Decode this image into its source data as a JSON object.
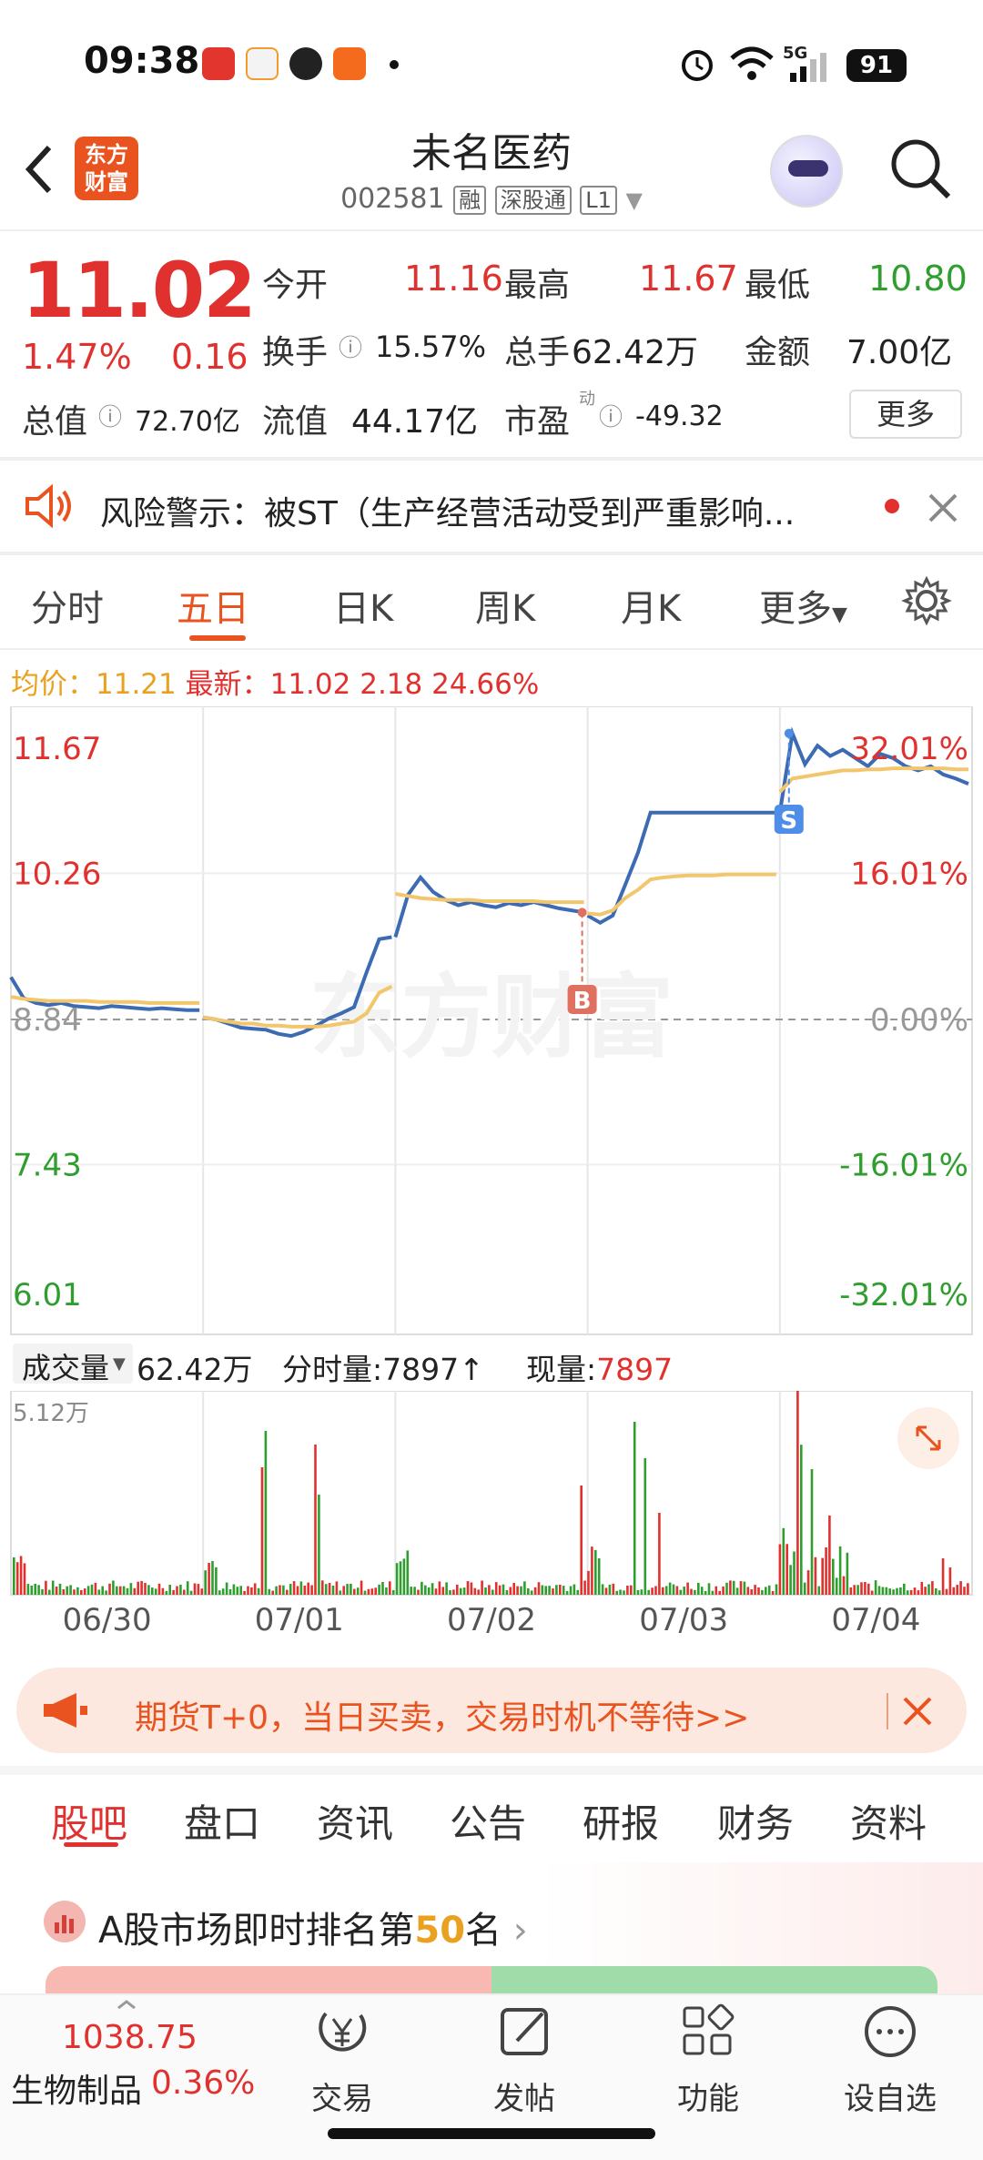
{
  "status": {
    "time": "09:38",
    "battery": "91",
    "signal": "5G"
  },
  "header": {
    "title": "未名医药",
    "code": "002581",
    "tags": [
      "融",
      "深股通",
      "L1"
    ]
  },
  "logo": {
    "line1": "东方",
    "line2": "财富"
  },
  "quote": {
    "price": "11.02",
    "change_pct": "1.47%",
    "change": "0.16",
    "open_label": "今开",
    "open": "11.16",
    "high_label": "最高",
    "high": "11.67",
    "low_label": "最低",
    "low": "10.80",
    "turnover_label": "换手",
    "turnover": "15.57%",
    "volume_label": "总手",
    "volume": "62.42万",
    "amount_label": "金额",
    "amount": "7.00亿",
    "mktcap_label": "总值",
    "mktcap": "72.70亿",
    "float_label": "流值",
    "float": "44.17亿",
    "pe_label": "市盈",
    "pe_sup": "动",
    "pe": "-49.32",
    "more": "更多"
  },
  "risk": {
    "text": "风险警示：被ST（生产经营活动受到严重影响..."
  },
  "chart_tabs": [
    "分时",
    "五日",
    "日K",
    "周K",
    "月K",
    "更多"
  ],
  "ticker": {
    "avg_label": "均价：",
    "avg": "11.21",
    "last_label": "最新：",
    "last": "11.02",
    "chg": "2.18",
    "pct": "24.66%"
  },
  "chart_data": {
    "type": "line",
    "y_left_ticks": [
      "11.67",
      "10.26",
      "8.84",
      "7.43",
      "6.01"
    ],
    "y_right_ticks": [
      "32.01%",
      "16.01%",
      "0.00%",
      "-16.01%",
      "-32.01%"
    ],
    "ylim": [
      6.01,
      11.67
    ],
    "days": [
      "06/30",
      "07/01",
      "07/02",
      "07/03",
      "07/04"
    ],
    "series": [
      {
        "name": "最新",
        "color": "#3d6bb3",
        "values": [
          9.25,
          9.05,
          9.0,
          8.98,
          9.0,
          8.97,
          8.96,
          8.95,
          8.97,
          8.96,
          8.95,
          8.94,
          8.95,
          8.94,
          8.93,
          8.93,
          8.86,
          8.84,
          8.8,
          8.76,
          8.75,
          8.74,
          8.7,
          8.68,
          8.72,
          8.78,
          8.85,
          8.9,
          8.96,
          9.3,
          9.62,
          9.64,
          9.64,
          10.05,
          10.22,
          10.08,
          10.0,
          9.95,
          9.98,
          9.95,
          9.93,
          9.97,
          9.95,
          9.98,
          9.95,
          9.92,
          9.9,
          9.88,
          9.85,
          9.78,
          9.85,
          10.15,
          10.46,
          10.85,
          10.85,
          10.85,
          10.85,
          10.85,
          10.85,
          10.85,
          10.85,
          10.85,
          10.85,
          10.85,
          10.85,
          11.62,
          11.32,
          11.5,
          11.4,
          11.46,
          11.38,
          11.3,
          11.42,
          11.38,
          11.3,
          11.26,
          11.3,
          11.22,
          11.18,
          11.13
        ]
      },
      {
        "name": "均价",
        "color": "#f2c66d",
        "values": [
          9.06,
          9.04,
          9.03,
          9.02,
          9.02,
          9.02,
          9.02,
          9.01,
          9.01,
          9.01,
          9.01,
          9.0,
          9.0,
          9.0,
          9.0,
          9.0,
          8.86,
          8.84,
          8.82,
          8.8,
          8.8,
          8.78,
          8.78,
          8.77,
          8.77,
          8.77,
          8.78,
          8.8,
          8.82,
          8.9,
          9.1,
          9.16,
          10.06,
          10.04,
          10.02,
          10.01,
          10.0,
          10.0,
          10.0,
          9.99,
          9.99,
          9.99,
          9.99,
          9.99,
          9.98,
          9.98,
          9.98,
          9.98,
          9.87,
          9.86,
          9.9,
          10.02,
          10.1,
          10.2,
          10.22,
          10.23,
          10.24,
          10.24,
          10.24,
          10.25,
          10.25,
          10.25,
          10.25,
          10.25,
          11.05,
          11.18,
          11.2,
          11.22,
          11.24,
          11.26,
          11.26,
          11.27,
          11.27,
          11.28,
          11.28,
          11.28,
          11.28,
          11.28,
          11.27,
          11.27
        ]
      }
    ],
    "markers": [
      {
        "label": "B",
        "color": "#e07060"
      },
      {
        "label": "S",
        "color": "#4f8ee8"
      }
    ],
    "watermark": "东方财富"
  },
  "volume": {
    "label": "成交量",
    "total": "62.42万",
    "tick_label": "分时量:",
    "tick_val": "7897",
    "now_label": "现量:",
    "now_val": "7897",
    "max": "5.12万"
  },
  "ad": {
    "text": "期货T+0，当日买卖，交易时机不等待>>"
  },
  "sub_tabs": [
    "股吧",
    "盘口",
    "资讯",
    "公告",
    "研报",
    "财务",
    "资料"
  ],
  "rank": {
    "pre": "A股市场即时排名第",
    "num": "50",
    "post": "名"
  },
  "nav": {
    "sector_value": "1038.75",
    "sector_name": "生物制品",
    "sector_pct": "0.36%",
    "items": [
      "交易",
      "发帖",
      "功能",
      "设自选"
    ]
  }
}
